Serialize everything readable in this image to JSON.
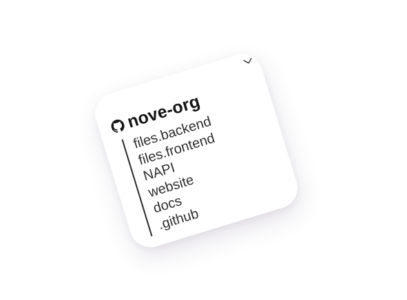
{
  "org": {
    "name": "nove-org",
    "icon": "github-icon"
  },
  "toggle": {
    "icon": "chevron-down-icon"
  },
  "repos": [
    {
      "label": "files.backend"
    },
    {
      "label": "files.frontend"
    },
    {
      "label": "NAPI"
    },
    {
      "label": "website"
    },
    {
      "label": "docs"
    },
    {
      "label": ".github"
    }
  ],
  "colors": {
    "text": "#2e2e2e",
    "heading": "#151515",
    "card": "#ffffff",
    "shadow": "#46325a"
  }
}
